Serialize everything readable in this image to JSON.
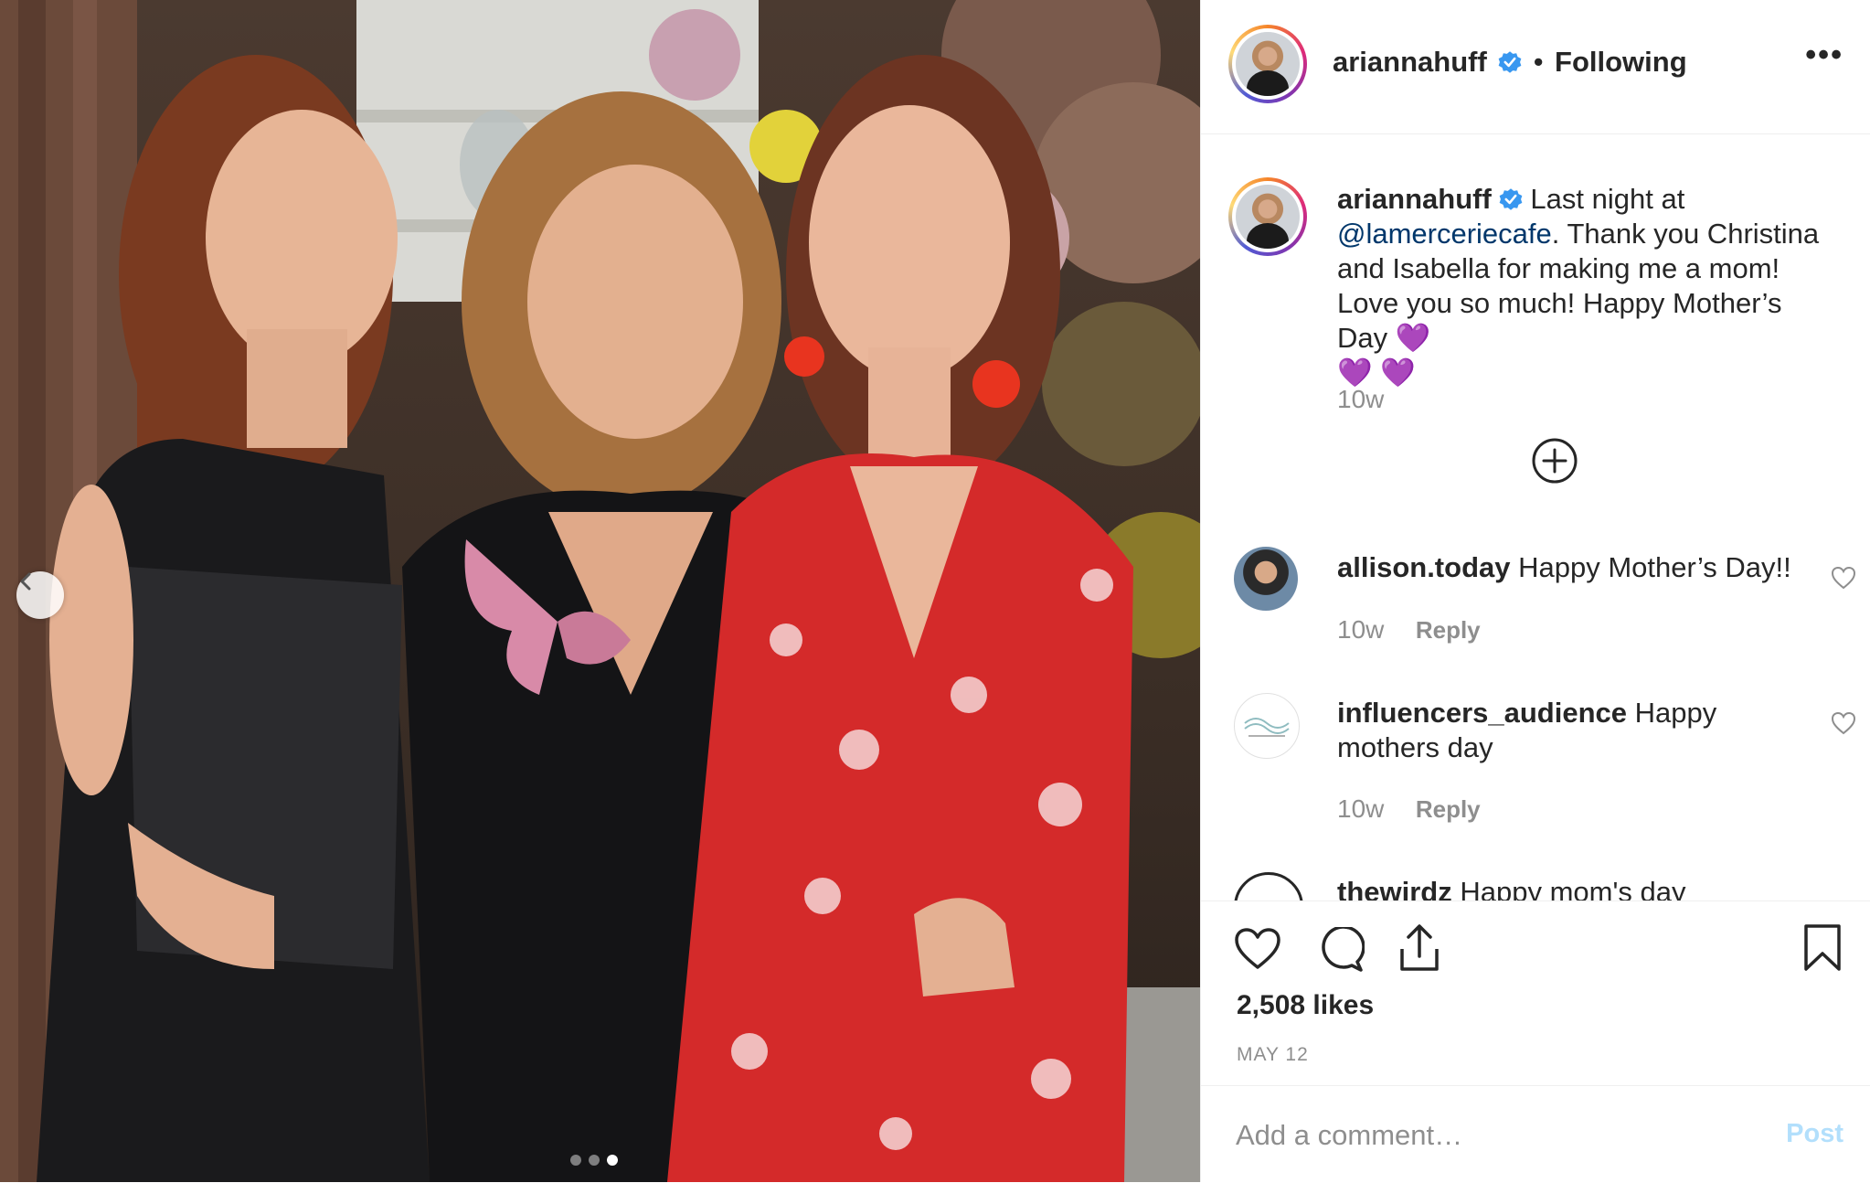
{
  "post": {
    "username": "ariannahuff",
    "follow_separator": "•",
    "follow_status": "Following",
    "more_label": "•••"
  },
  "caption": {
    "username": "ariannahuff",
    "text_before": "Last night at",
    "mention": "@lamerceriecafe",
    "text_after": ". Thank you Christina and Isabella for making me a mom! Love you so much! Happy Mother’s Day 💜",
    "emoji_line": "💜 💜",
    "time": "10w"
  },
  "comments": [
    {
      "username": "allison.today",
      "text": "Happy Mother’s Day!!",
      "time": "10w",
      "reply": "Reply"
    },
    {
      "username": "influencers_audience",
      "text": "Happy mothers day",
      "time": "10w",
      "reply": "Reply"
    },
    {
      "username": "thewirdz",
      "text": "Happy mom's day"
    }
  ],
  "actions": {
    "likes": "2,508 likes",
    "date": "MAY 12"
  },
  "comment_box": {
    "placeholder": "Add a comment…",
    "post_label": "Post"
  },
  "carousel": {
    "total": 3,
    "active_index": 2
  },
  "colors": {
    "verified": "#3897f0",
    "link": "#00376b",
    "muted": "#8e8e8e",
    "post_disabled": "#b2dffc",
    "emoji_purple": "#a64ddf"
  }
}
